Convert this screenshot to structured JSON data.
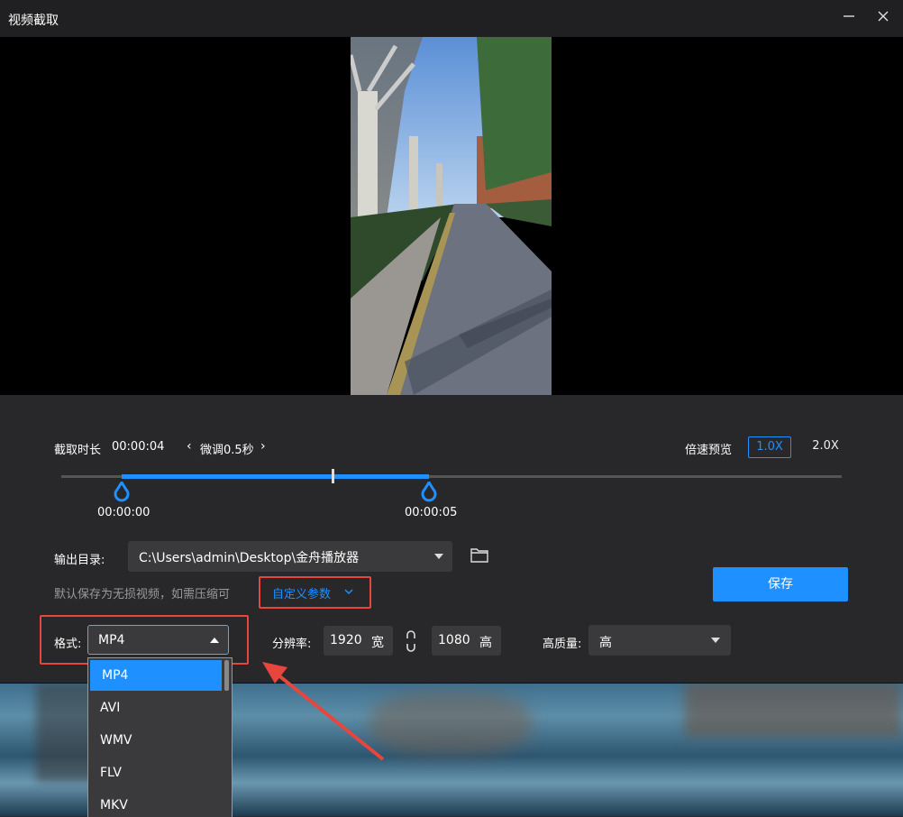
{
  "window": {
    "title": "视频截取"
  },
  "trim": {
    "duration_label": "截取时长",
    "duration_value": "00:00:04",
    "fine_tune_label": "微调0.5秒",
    "start_time": "00:00:00",
    "end_time": "00:00:05"
  },
  "speed": {
    "label": "倍速预览",
    "options": [
      "1.0X",
      "2.0X"
    ],
    "selected": "1.0X"
  },
  "output": {
    "dir_label": "输出目录:",
    "dir_value": "C:\\Users\\admin\\Desktop\\金舟播放器",
    "hint": "默认保存为无损视频，如需压缩可",
    "custom_params": "自定义参数",
    "save_label": "保存"
  },
  "format": {
    "label": "格式:",
    "selected": "MP4",
    "options": [
      "MP4",
      "AVI",
      "WMV",
      "FLV",
      "MKV"
    ]
  },
  "resolution": {
    "label": "分辨率:",
    "width_value": "1920",
    "width_unit": "宽",
    "height_value": "1080",
    "height_unit": "高"
  },
  "quality": {
    "label": "高质量:",
    "selected": "高"
  },
  "colors": {
    "accent": "#1e90ff",
    "highlight_box": "#e8453c",
    "panel": "#28282a"
  }
}
